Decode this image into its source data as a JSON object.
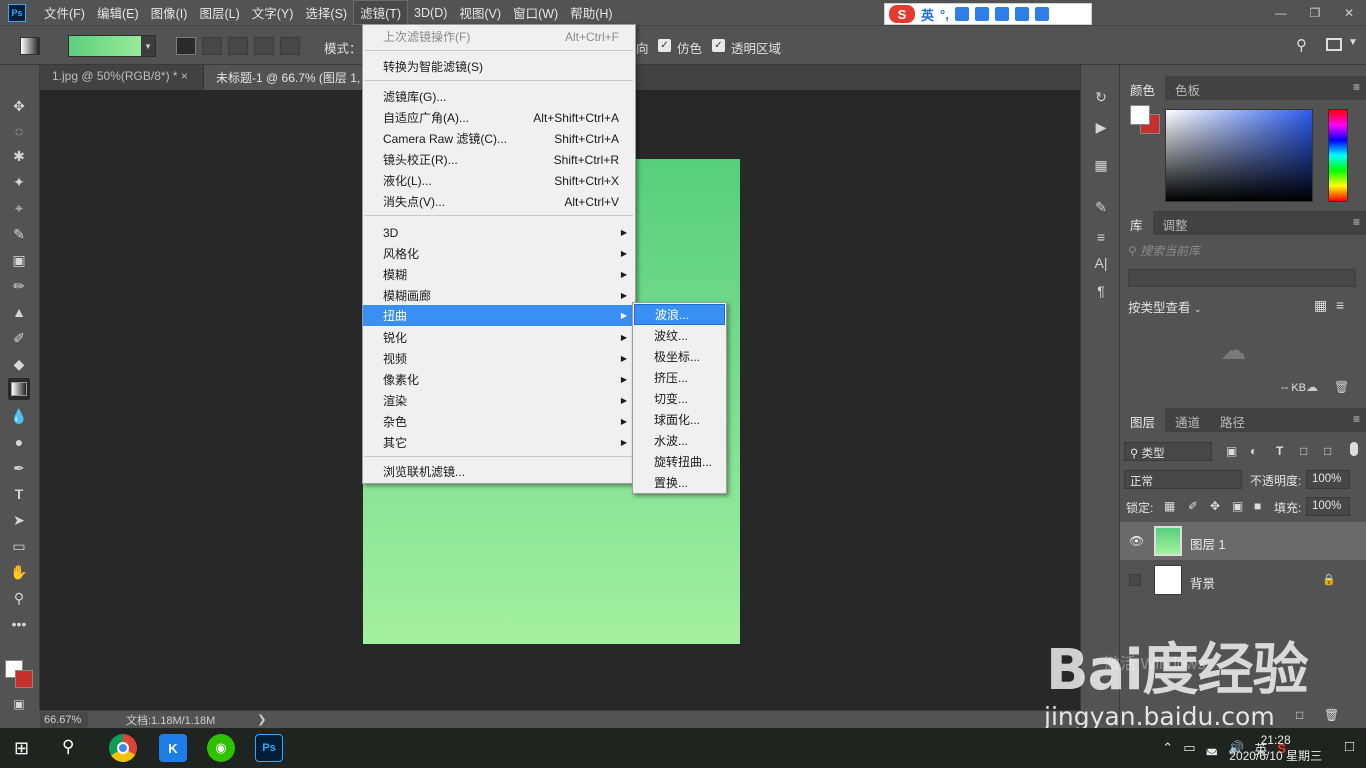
{
  "menubar": {
    "logo": "Ps",
    "items": [
      "文件(F)",
      "编辑(E)",
      "图像(I)",
      "图层(L)",
      "文字(Y)",
      "选择(S)",
      "滤镜(T)",
      "3D(D)",
      "视图(V)",
      "窗口(W)",
      "帮助(H)"
    ],
    "active_index": 6
  },
  "ime": {
    "label": "英"
  },
  "options": {
    "mode_label": "模式：",
    "dither_label": "仿色",
    "transparency_label": "透明区域",
    "reverse_label": "向"
  },
  "tabs": [
    "1.jpg @ 50%(RGB/8*) *",
    "未标题-1 @ 66.7% (图层 1,"
  ],
  "filter_menu": {
    "items": [
      {
        "label": "上次滤镜操作(F)",
        "shortcut": "Alt+Ctrl+F",
        "disabled": true
      },
      {
        "label": "转换为智能滤镜(S)",
        "shortcut": ""
      },
      {
        "label": "滤镜库(G)...",
        "shortcut": ""
      },
      {
        "label": "自适应广角(A)...",
        "shortcut": "Alt+Shift+Ctrl+A"
      },
      {
        "label": "Camera Raw 滤镜(C)...",
        "shortcut": "Shift+Ctrl+A"
      },
      {
        "label": "镜头校正(R)...",
        "shortcut": "Shift+Ctrl+R"
      },
      {
        "label": "液化(L)...",
        "shortcut": "Shift+Ctrl+X"
      },
      {
        "label": "消失点(V)...",
        "shortcut": "Alt+Ctrl+V"
      },
      {
        "label": "3D",
        "submenu": true
      },
      {
        "label": "风格化",
        "submenu": true
      },
      {
        "label": "模糊",
        "submenu": true
      },
      {
        "label": "模糊画廊",
        "submenu": true
      },
      {
        "label": "扭曲",
        "submenu": true,
        "highlighted": true
      },
      {
        "label": "锐化",
        "submenu": true
      },
      {
        "label": "视频",
        "submenu": true
      },
      {
        "label": "像素化",
        "submenu": true
      },
      {
        "label": "渲染",
        "submenu": true
      },
      {
        "label": "杂色",
        "submenu": true
      },
      {
        "label": "其它",
        "submenu": true
      },
      {
        "label": "浏览联机滤镜...",
        "shortcut": ""
      }
    ]
  },
  "distort_submenu": [
    "波浪...",
    "波纹...",
    "极坐标...",
    "挤压...",
    "切变...",
    "球面化...",
    "水波...",
    "旋转扭曲...",
    "置换..."
  ],
  "status": {
    "zoom": "66.67%",
    "doc": "文档:1.18M/1.18M"
  },
  "color_panel": {
    "tabs": [
      "颜色",
      "色板"
    ]
  },
  "library_panel": {
    "tabs": [
      "库",
      "调整"
    ],
    "search_placeholder": "搜索当前库",
    "view_label": "按类型查看",
    "size": "-- KB"
  },
  "layers_panel": {
    "tabs": [
      "图层",
      "通道",
      "路径"
    ],
    "filter": "类型",
    "blend_mode": "正常",
    "opacity_label": "不透明度:",
    "opacity": "100%",
    "lock_label": "锁定:",
    "fill_label": "填充:",
    "fill": "100%",
    "layers": [
      {
        "name": "图层 1",
        "selected": true
      },
      {
        "name": "背景",
        "selected": false
      }
    ]
  },
  "taskbar": {
    "time": "21:28",
    "date": "2020/6/10 星期三",
    "ime": "英"
  },
  "watermark": {
    "logo": "Bai度经验",
    "url": "jingyan.baidu.com",
    "activate": "激活 Windows"
  },
  "colors": {
    "accent": "#3a8ff2",
    "canvas_top": "#56cf7b",
    "canvas_bottom": "#a3f0a0"
  }
}
